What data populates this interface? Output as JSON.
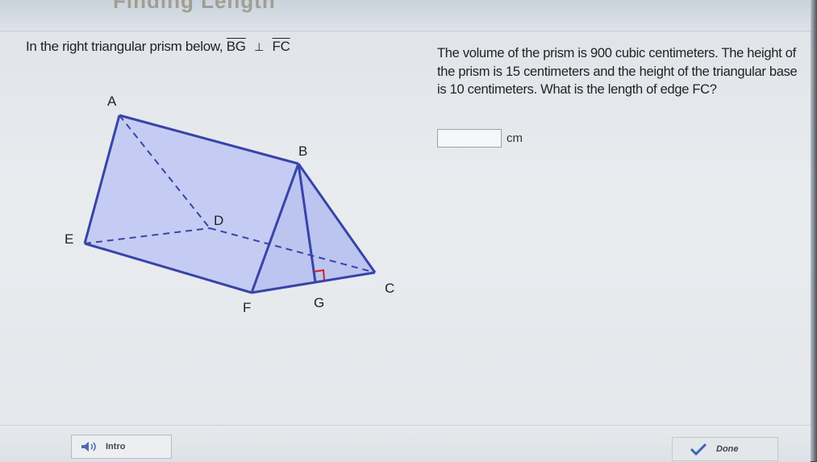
{
  "banner": {
    "title": "Finding Length"
  },
  "question": {
    "prefix": "In the right triangular prism below,",
    "segment1": "BG",
    "perp_symbol": "⊥",
    "segment2": "FC"
  },
  "problem": {
    "text": "The volume of the prism is 900 cubic centimeters. The height of the prism is 15 centimeters and the height of the triangular base is 10 centimeters. What is the length of edge FC?"
  },
  "answer": {
    "value": "",
    "unit": "cm"
  },
  "figure": {
    "labels": {
      "A": "A",
      "B": "B",
      "C": "C",
      "D": "D",
      "E": "E",
      "F": "F",
      "G": "G"
    },
    "fill_color": "#c5ccf3",
    "edge_color": "#3844a8"
  },
  "footer": {
    "intro_label": "Intro",
    "intro_icon": "speaker-icon",
    "done_label": "Done",
    "done_icon": "check-icon"
  }
}
